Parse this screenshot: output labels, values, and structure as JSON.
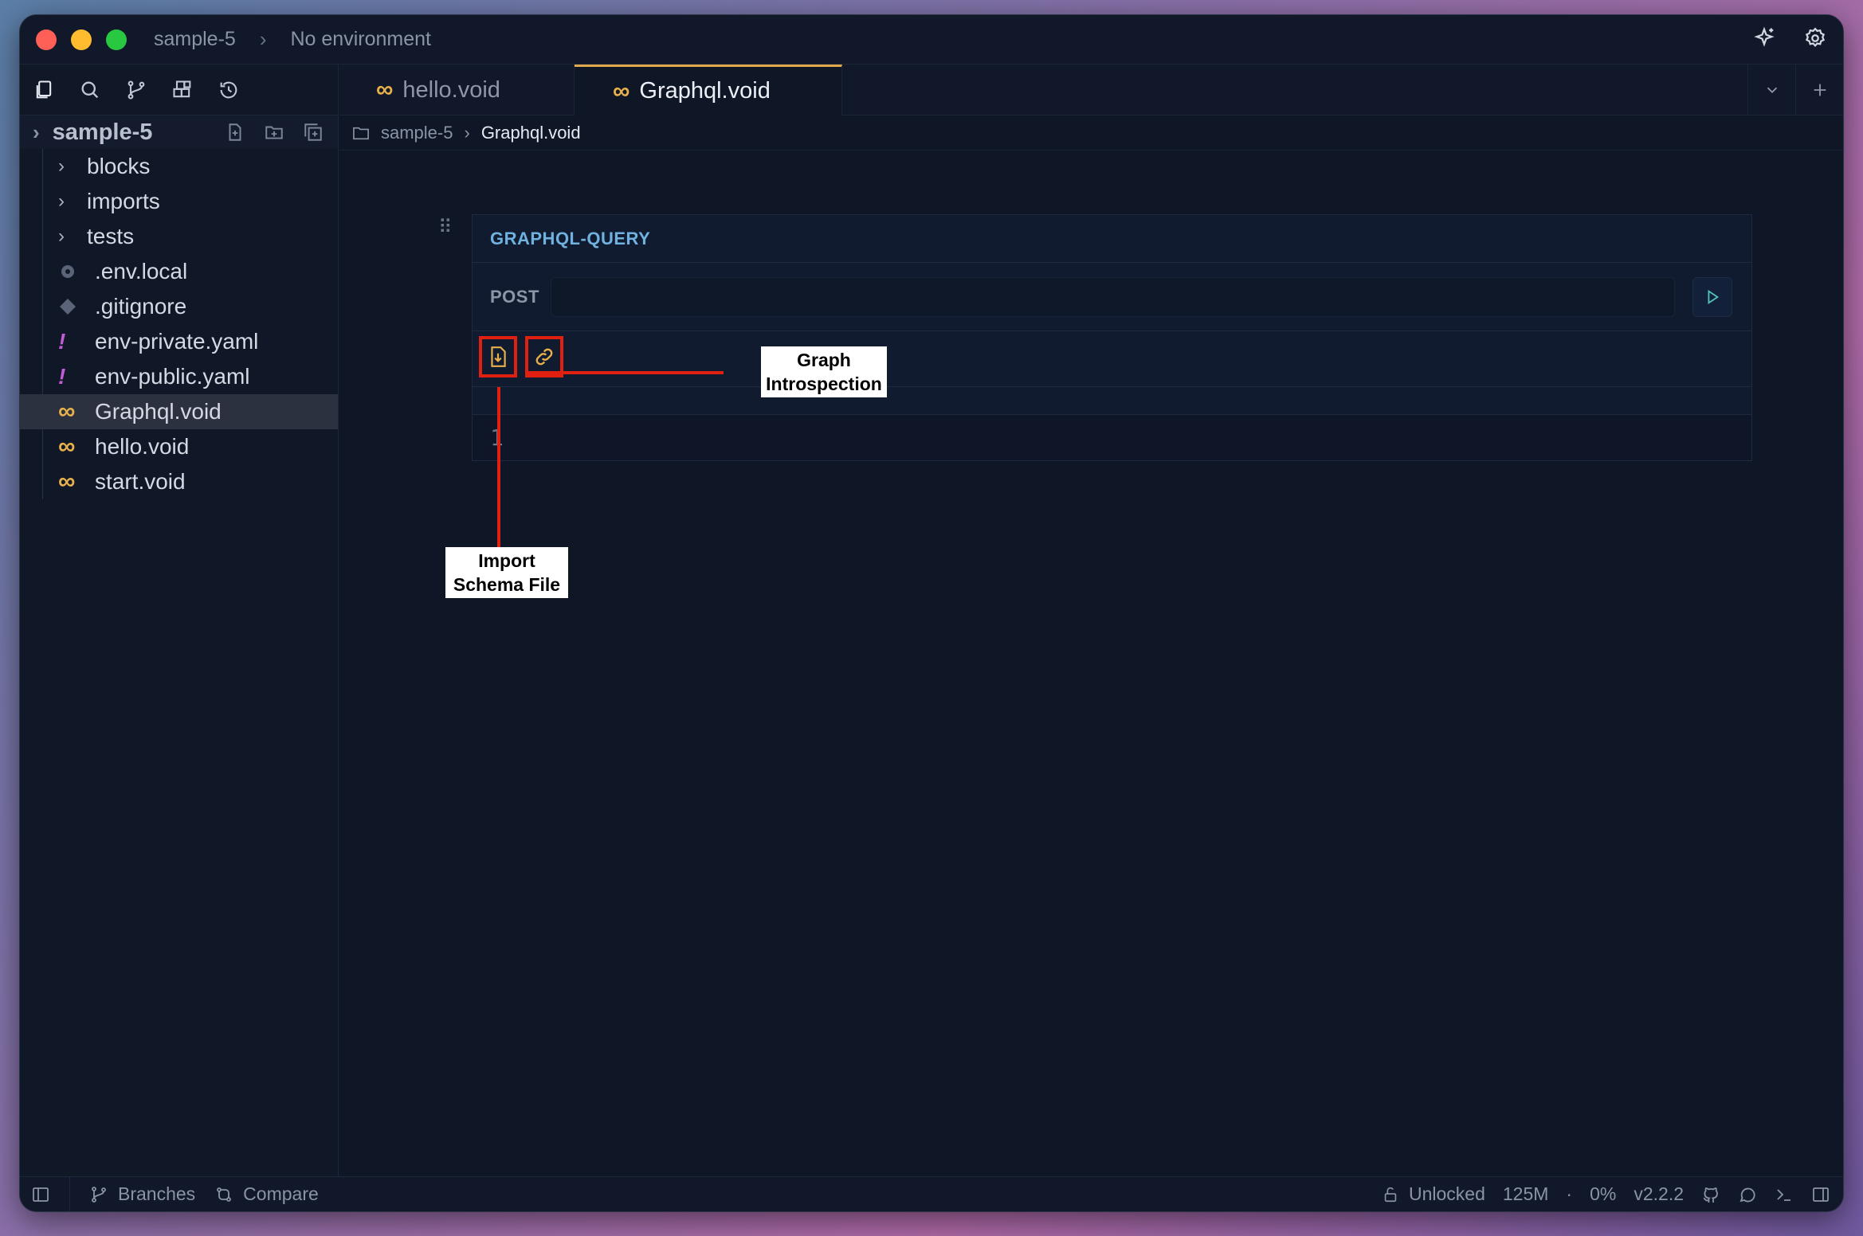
{
  "titlebar": {
    "project": "sample-5",
    "environment": "No environment"
  },
  "sidebar": {
    "root_label": "sample-5",
    "items": [
      {
        "label": "blocks",
        "type": "folder"
      },
      {
        "label": "imports",
        "type": "folder"
      },
      {
        "label": "tests",
        "type": "folder"
      },
      {
        "label": ".env.local",
        "type": "env"
      },
      {
        "label": ".gitignore",
        "type": "git"
      },
      {
        "label": "env-private.yaml",
        "type": "yaml"
      },
      {
        "label": "env-public.yaml",
        "type": "yaml"
      },
      {
        "label": "Graphql.void",
        "type": "void",
        "selected": true
      },
      {
        "label": "hello.void",
        "type": "void"
      },
      {
        "label": "start.void",
        "type": "void"
      }
    ]
  },
  "tabs": [
    {
      "label": "hello.void",
      "active": false
    },
    {
      "label": "Graphql.void",
      "active": true
    }
  ],
  "breadcrumb": {
    "folder": "sample-5",
    "file": "Graphql.void"
  },
  "block": {
    "title": "GRAPHQL-QUERY",
    "method": "POST",
    "url": "",
    "line_number": "1"
  },
  "annotations": {
    "introspection": "Graph Introspection",
    "introspection_line1": "Graph",
    "introspection_line2": "Introspection",
    "import_line1": "Import",
    "import_line2": "Schema File"
  },
  "statusbar": {
    "branches": "Branches",
    "compare": "Compare",
    "lock": "Unlocked",
    "memory": "125M",
    "cpu": "0%",
    "version": "v2.2.2"
  },
  "colors": {
    "accent_tab": "#e1a94a",
    "callout": "#e02010",
    "block_title": "#6fb2e0"
  }
}
